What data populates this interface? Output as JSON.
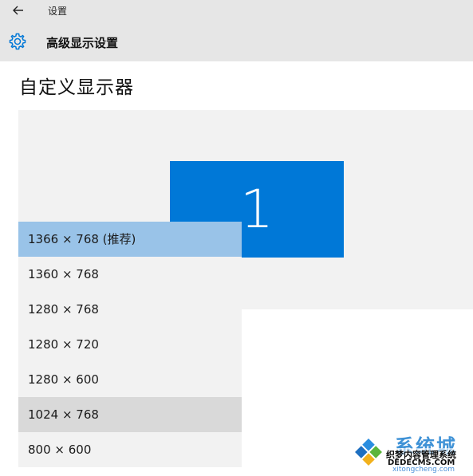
{
  "window": {
    "title": "设置",
    "back_icon": "arrow-left-icon"
  },
  "header": {
    "icon": "gear-icon",
    "title": "高级显示设置"
  },
  "main": {
    "section_title": "自定义显示器",
    "monitor_label": "1",
    "monitor_color": "#0078d7"
  },
  "resolution_list": {
    "items": [
      {
        "label": "1366 × 768 (推荐)",
        "state": "selected"
      },
      {
        "label": "1360 × 768",
        "state": "normal"
      },
      {
        "label": "1280 × 768",
        "state": "normal"
      },
      {
        "label": "1280 × 720",
        "state": "normal"
      },
      {
        "label": "1280 × 600",
        "state": "normal"
      },
      {
        "label": "1024 × 768",
        "state": "hovered"
      },
      {
        "label": "800 × 600",
        "state": "normal"
      }
    ],
    "selected_color": "#99c3e8",
    "hover_color": "#d9d9d9"
  },
  "watermark": {
    "brand": "系统城",
    "line1": "织梦内容管理系统",
    "line2": "DEDECMS.COM",
    "url": "xitongcheng.com"
  }
}
